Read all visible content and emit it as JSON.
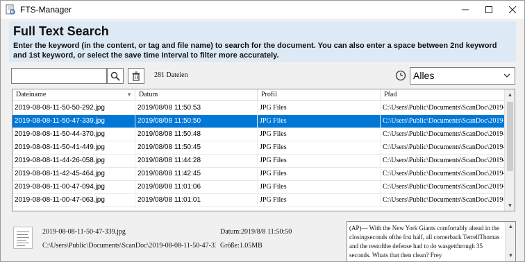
{
  "window": {
    "title": "FTS-Manager"
  },
  "header": {
    "title": "Full Text Search",
    "description": "Enter the keyword (in the content, or tag and file name) to search for the document. You can also enter a space between 2nd keyword and 1st keyword, or select the save time Interval to filter more accurately."
  },
  "search": {
    "value": "",
    "count_label": "281 Dateien"
  },
  "time_filter": {
    "selected": "Alles"
  },
  "grid": {
    "columns": [
      "Dateiname",
      "Datum",
      "Profil",
      "Pfad"
    ],
    "rows": [
      {
        "name": "2019-08-08-11-50-50-292.jpg",
        "date": "2019/08/08 11:50:53",
        "profile": "JPG Files",
        "path": "C:\\Users\\Public\\Documents\\ScanDoc\\2019-0...",
        "selected": false
      },
      {
        "name": "2019-08-08-11-50-47-339.jpg",
        "date": "2019/08/08 11:50:50",
        "profile": "JPG Files",
        "path": "C:\\Users\\Public\\Documents\\ScanDoc\\2019-0...",
        "selected": true
      },
      {
        "name": "2019-08-08-11-50-44-370.jpg",
        "date": "2019/08/08 11:50:48",
        "profile": "JPG Files",
        "path": "C:\\Users\\Public\\Documents\\ScanDoc\\2019-0...",
        "selected": false
      },
      {
        "name": "2019-08-08-11-50-41-449.jpg",
        "date": "2019/08/08 11:50:45",
        "profile": "JPG Files",
        "path": "C:\\Users\\Public\\Documents\\ScanDoc\\2019-0...",
        "selected": false
      },
      {
        "name": "2019-08-08-11-44-26-058.jpg",
        "date": "2019/08/08 11:44:28",
        "profile": "JPG Files",
        "path": "C:\\Users\\Public\\Documents\\ScanDoc\\2019-0...",
        "selected": false
      },
      {
        "name": "2019-08-08-11-42-45-464.jpg",
        "date": "2019/08/08 11:42:45",
        "profile": "JPG Files",
        "path": "C:\\Users\\Public\\Documents\\ScanDoc\\2019-0...",
        "selected": false
      },
      {
        "name": "2019-08-08-11-00-47-094.jpg",
        "date": "2019/08/08 11:01:06",
        "profile": "JPG Files",
        "path": "C:\\Users\\Public\\Documents\\ScanDoc\\2019-0...",
        "selected": false
      },
      {
        "name": "2019-08-08-11-00-47-063.jpg",
        "date": "2019/08/08 11:01:01",
        "profile": "JPG Files",
        "path": "C:\\Users\\Public\\Documents\\ScanDoc\\2019-0...",
        "selected": false
      }
    ]
  },
  "detail": {
    "file_name": "2019-08-08-11-50-47-339.jpg",
    "date": "Datum:2019/8/8 11:50:50",
    "path": "C:\\Users\\Public\\Documents\\ScanDoc\\2019-08-08-11-50-47-339.jp",
    "size": "Größe:1.05MB",
    "preview_text": "(AP)— With the New York Giants comfortably ahead in the closingseconds ofthe frst half, all cornerback TerrellThomas and the restofthe defense had to do wasgetthrough 35 seconds. Whats that then clean? Frey"
  },
  "colors": {
    "header_bg": "#dde9f5",
    "selection": "#0078d7"
  }
}
